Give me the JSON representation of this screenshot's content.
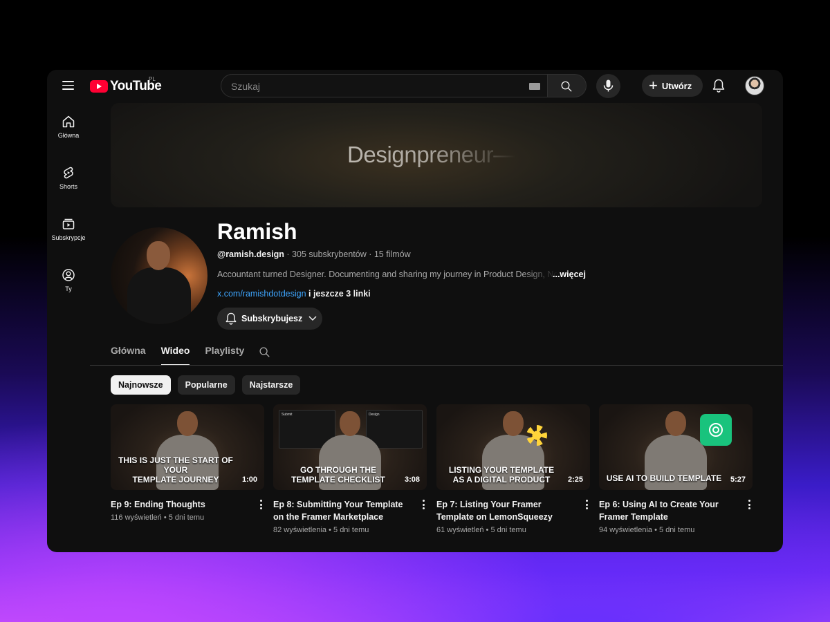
{
  "header": {
    "logo_text": "YouTube",
    "logo_country": "PL",
    "search_placeholder": "Szukaj",
    "create_label": "Utwórz"
  },
  "sidebar": {
    "items": [
      {
        "label": "Główna",
        "icon": "home-icon"
      },
      {
        "label": "Shorts",
        "icon": "shorts-icon"
      },
      {
        "label": "Subskrypcje",
        "icon": "subscriptions-icon"
      },
      {
        "label": "Ty",
        "icon": "you-icon"
      }
    ]
  },
  "banner": {
    "text": "Designpreneur—"
  },
  "channel": {
    "name": "Ramish",
    "handle": "@ramish.design",
    "stats": " · 305 subskrybentów · 15 filmów",
    "description": "Accountant turned Designer. Documenting and sharing my journey in Product Design, No",
    "more_label": "...więcej",
    "link": "x.com/ramishdotdesign",
    "links_more": " i jeszcze 3 linki",
    "subscribe_label": "Subskrybujesz"
  },
  "tabs": [
    {
      "label": "Główna",
      "active": false
    },
    {
      "label": "Wideo",
      "active": true
    },
    {
      "label": "Playlisty",
      "active": false
    }
  ],
  "chips": [
    {
      "label": "Najnowsze",
      "active": true
    },
    {
      "label": "Popularne",
      "active": false
    },
    {
      "label": "Najstarsze",
      "active": false
    }
  ],
  "videos": [
    {
      "caption_line1": "THIS IS JUST THE START OF YOUR",
      "caption_line2": "TEMPLATE JOURNEY",
      "duration": "1:00",
      "title": "Ep 9: Ending Thoughts",
      "views": "116 wyświetleń",
      "age": "5 dni temu"
    },
    {
      "caption_line1": "GO THROUGH THE",
      "caption_line2": "TEMPLATE CHECKLIST",
      "duration": "3:08",
      "title": "Ep 8: Submitting Your Template on the Framer Marketplace",
      "views": "82 wyświetlenia",
      "age": "5 dni temu",
      "panel_left_title": "Submit",
      "panel_right_title": "Design"
    },
    {
      "caption_line1": "LISTING YOUR TEMPLATE",
      "caption_line2": "AS A DIGITAL PRODUCT",
      "duration": "2:25",
      "title": "Ep 7: Listing Your Framer Template on LemonSqueezy",
      "views": "61 wyświetleń",
      "age": "5 dni temu"
    },
    {
      "caption_line1": "USE AI TO BUILD TEMPLATE",
      "caption_line2": "",
      "duration": "5:27",
      "title": "Ep 6: Using AI to Create Your Framer Template",
      "views": "94 wyświetlenia",
      "age": "5 dni temu"
    }
  ],
  "colors": {
    "background": "#0f0f0f",
    "brand_red": "#ff0033",
    "link_blue": "#3ea6ff",
    "chatgpt_green": "#19c37d"
  }
}
